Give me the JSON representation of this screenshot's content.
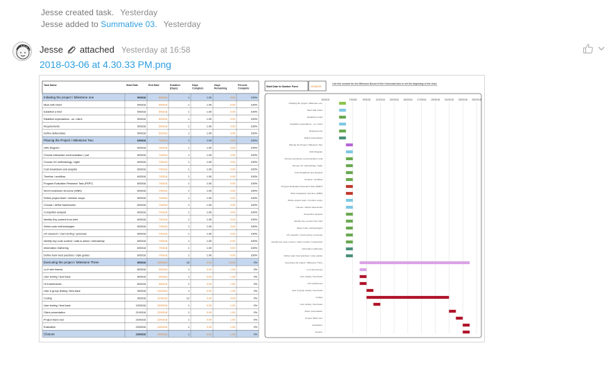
{
  "activity": [
    {
      "text": "Jesse created task.",
      "when": "Yesterday",
      "link": ""
    },
    {
      "text": "Jesse added to ",
      "link": "Summative 03.",
      "when": "Yesterday"
    }
  ],
  "message": {
    "author": "Jesse",
    "verb": "attached",
    "timestamp": "Yesterday at 16:58",
    "attachment": "2018-03-06 at 4.30.33 PM.png"
  },
  "icons": {
    "avatar": "avatar-sketch-icon",
    "attach": "paperclip-icon",
    "like": "thumbs-up-icon",
    "menu": "chevron-down-icon"
  },
  "colors": {
    "link": "#2d9ee0",
    "milestone_row": "#c5d7ee",
    "date_orange": "#e07b1a"
  },
  "attachment_image": {
    "table_headers": [
      "Task Name",
      "Start Date",
      "End Date",
      "Duration (Days)",
      "Days Complete",
      "Days Remaining",
      "Percent Complete"
    ],
    "start_box_label": "Start Date in Number Form",
    "start_box_value": "43158.00",
    "note": "Use this number for the Minimum Bound of the Horizontal Axis to set the beginning of the chart.",
    "axis_ticks": [
      "3/03/18",
      "7/03/18",
      "9/03/18",
      "11/03/18",
      "13/03/18",
      "15/03/18",
      "17/03/18",
      "19/03/18",
      "21/03/18",
      "23/03/18",
      "25/03/18"
    ],
    "rows": [
      {
        "task": "Initiating the project / Milestone one",
        "start": "5/03/18",
        "end": "5/03/18",
        "dur": "1",
        "done": "1.00",
        "rem": "0.00",
        "pct": "100%",
        "ms": true,
        "color": "#8bc34a",
        "s": 5,
        "e": 6
      },
      {
        "task": "Meet with Client",
        "start": "5/03/18",
        "end": "5/03/18",
        "dur": "1",
        "done": "1.00",
        "rem": "0.00",
        "pct": "100%",
        "ms": false,
        "color": "#7ec8e3",
        "s": 5,
        "e": 6
      },
      {
        "task": "Establish a brief",
        "start": "5/03/18",
        "end": "5/03/18",
        "dur": "1",
        "done": "1.00",
        "rem": "0.00",
        "pct": "100%",
        "ms": false,
        "color": "#6aa84f",
        "s": 5,
        "e": 6
      },
      {
        "task": "Establish expectations - us / client",
        "start": "5/03/18",
        "end": "5/03/18",
        "dur": "1",
        "done": "1.00",
        "rem": "0.00",
        "pct": "100%",
        "ms": false,
        "color": "#7ec8e3",
        "s": 5,
        "e": 6
      },
      {
        "task": "Requirements",
        "start": "5/03/18",
        "end": "5/03/18",
        "dur": "1",
        "done": "1.00",
        "rem": "0.00",
        "pct": "100%",
        "ms": false,
        "color": "#6aa84f",
        "s": 5,
        "e": 6
      },
      {
        "task": "Define deliverables",
        "start": "5/03/18",
        "end": "5/03/18",
        "dur": "1",
        "done": "1.00",
        "rem": "0.00",
        "pct": "100%",
        "ms": false,
        "color": "#4a8f7a",
        "s": 5,
        "e": 6
      },
      {
        "task": "Plannig the Project / Milestone Two",
        "start": "6/03/18",
        "end": "7/03/18",
        "dur": "1",
        "done": "1.00",
        "rem": "0.00",
        "pct": "100%",
        "ms": true,
        "color": "#b266d6",
        "s": 6,
        "e": 7
      },
      {
        "task": "UML Diagram",
        "start": "6/03/18",
        "end": "7/03/18",
        "dur": "1",
        "done": "1.00",
        "rem": "0.00",
        "pct": "100%",
        "ms": false,
        "color": "#7ec8e3",
        "s": 6,
        "e": 7
      },
      {
        "task": "Choose interactive communication / pull",
        "start": "6/03/18",
        "end": "7/03/18",
        "dur": "1",
        "done": "1.00",
        "rem": "0.00",
        "pct": "100%",
        "ms": false,
        "color": "#6aa84f",
        "s": 6,
        "e": 7
      },
      {
        "task": "Choose UX methodology / Agile",
        "start": "6/03/18",
        "end": "7/03/18",
        "dur": "1",
        "done": "1.00",
        "rem": "0.00",
        "pct": "100%",
        "ms": false,
        "color": "#6aa84f",
        "s": 6,
        "e": 7
      },
      {
        "task": "Cost breakdown and  anaylsis",
        "start": "6/03/18",
        "end": "7/03/18",
        "dur": "1",
        "done": "1.00",
        "rem": "0.00",
        "pct": "100%",
        "ms": false,
        "color": "#6aa84f",
        "s": 6,
        "e": 7
      },
      {
        "task": "Timeline / workflow",
        "start": "6/03/18",
        "end": "7/03/18",
        "dur": "1",
        "done": "1.00",
        "rem": "0.00",
        "pct": "100%",
        "ms": false,
        "color": "#6aa84f",
        "s": 6,
        "e": 7
      },
      {
        "task": "Program Evaluation Research Task (PERT)",
        "start": "6/03/18",
        "end": "7/03/18",
        "dur": "1",
        "done": "1.00",
        "rem": "0.00",
        "pct": "100%",
        "ms": false,
        "color": "#c0392b",
        "s": 6,
        "e": 7
      },
      {
        "task": "Work breakdown structure (WBS)",
        "start": "6/03/18",
        "end": "7/03/18",
        "dur": "1",
        "done": "1.00",
        "rem": "0.00",
        "pct": "100%",
        "ms": false,
        "color": "#c0392b",
        "s": 6,
        "e": 7
      },
      {
        "task": "Define project team / member scope",
        "start": "6/03/18",
        "end": "7/03/18",
        "dur": "1",
        "done": "1.00",
        "rem": "0.00",
        "pct": "100%",
        "ms": false,
        "color": "#7ec8e3",
        "s": 6,
        "e": 7
      },
      {
        "task": "Choose / define frameworks",
        "start": "6/03/18",
        "end": "7/03/18",
        "dur": "1",
        "done": "1.00",
        "rem": "0.00",
        "pct": "100%",
        "ms": false,
        "color": "#7ec8e3",
        "s": 6,
        "e": 7
      },
      {
        "task": "Competitor analysis",
        "start": "6/03/18",
        "end": "7/03/18",
        "dur": "1",
        "done": "1.00",
        "rem": "0.00",
        "pct": "100%",
        "ms": false,
        "color": "#6aa84f",
        "s": 6,
        "e": 7
      },
      {
        "task": "Identify Key content from brief",
        "start": "6/03/18",
        "end": "7/03/18",
        "dur": "1",
        "done": "1.00",
        "rem": "0.00",
        "pct": "100%",
        "ms": false,
        "color": "#6aa84f",
        "s": 6,
        "e": 7
      },
      {
        "task": "Select code methodologies",
        "start": "6/03/18",
        "end": "7/03/18",
        "dur": "1",
        "done": "1.00",
        "rem": "0.00",
        "pct": "100%",
        "ms": false,
        "color": "#6aa84f",
        "s": 6,
        "e": 7
      },
      {
        "task": "UX research / Card sorting / personas",
        "start": "6/03/18",
        "end": "7/03/18",
        "dur": "1",
        "done": "1.00",
        "rem": "0.00",
        "pct": "100%",
        "ms": false,
        "color": "#6aa84f",
        "s": 6,
        "e": 7
      },
      {
        "task": "Identify key code content / calls to action / interactivity",
        "start": "6/03/18",
        "end": "7/03/18",
        "dur": "1",
        "done": "1.00",
        "rem": "0.00",
        "pct": "100%",
        "ms": false,
        "color": "#6aa84f",
        "s": 6,
        "e": 7
      },
      {
        "task": "Information Gathering",
        "start": "6/03/18",
        "end": "7/03/18",
        "dur": "1",
        "done": "1.00",
        "rem": "0.00",
        "pct": "100%",
        "ms": false,
        "color": "#4a8f7a",
        "s": 6,
        "e": 7
      },
      {
        "task": "Define team best practises / style guides",
        "start": "6/03/18",
        "end": "7/03/18",
        "dur": "1",
        "done": "1.00",
        "rem": "0.00",
        "pct": "100%",
        "ms": false,
        "color": "#4a8f7a",
        "s": 6,
        "e": 7
      },
      {
        "task": "Executing the project / Milestone Three",
        "start": "8/03/18",
        "end": "23/03/18",
        "dur": "16",
        "done": "0.00",
        "rem": "13.00",
        "pct": "0%",
        "ms": true,
        "color": "#d9a3e6",
        "s": 8,
        "e": 24
      },
      {
        "task": "Lo-fi wire frames",
        "start": "8/03/18",
        "end": "9/03/18",
        "dur": "1",
        "done": "0.00",
        "rem": "1.00",
        "pct": "0%",
        "ms": false,
        "color": "#d9a3e6",
        "s": 8,
        "e": 9
      },
      {
        "task": "User testing / feed back",
        "start": "8/03/18",
        "end": "9/03/18",
        "dur": "1",
        "done": "0.00",
        "rem": "1.00",
        "pct": "0%",
        "ms": false,
        "color": "#b0152a",
        "s": 8,
        "e": 9
      },
      {
        "task": "Hi-fi wireframes",
        "start": "8/03/18",
        "end": "9/03/18",
        "dur": "1",
        "done": "0.00",
        "rem": "1.00",
        "pct": "0%",
        "ms": false,
        "color": "#b0152a",
        "s": 8,
        "e": 9
      },
      {
        "task": "User & group testing / feed back",
        "start": "9/03/18",
        "end": "10/03/18",
        "dur": "1",
        "done": "0.00",
        "rem": "1.00",
        "pct": "0%",
        "ms": false,
        "color": "#b0152a",
        "s": 9,
        "e": 10
      },
      {
        "task": "Coding",
        "start": "9/03/18",
        "end": "21/03/18",
        "dur": "12",
        "done": "0.00",
        "rem": "0.00",
        "pct": "0%",
        "ms": false,
        "color": "#b0152a",
        "s": 9,
        "e": 21
      },
      {
        "task": "User testing / feed back",
        "start": "10/03/18",
        "end": "20/03/18",
        "dur": "1",
        "done": "0.00",
        "rem": "1.00",
        "pct": "0%",
        "ms": false,
        "color": "#b0152a",
        "s": 10,
        "e": 11
      },
      {
        "task": "Client presentation",
        "start": "21/03/18",
        "end": "22/03/18",
        "dur": "1",
        "done": "0.00",
        "rem": "1.00",
        "pct": "0%",
        "ms": false,
        "color": "#b0152a",
        "s": 21,
        "e": 22
      },
      {
        "task": "Project Hand over",
        "start": "22/03/18",
        "end": "23/03/18",
        "dur": "1",
        "done": "0.00",
        "rem": "1.00",
        "pct": "0%",
        "ms": false,
        "color": "#b0152a",
        "s": 22,
        "e": 23
      },
      {
        "task": "Evaluation",
        "start": "23/03/18",
        "end": "24/03/18",
        "dur": "1",
        "done": "0.00",
        "rem": "1.00",
        "pct": "0%",
        "ms": false,
        "color": "#b0152a",
        "s": 23,
        "e": 24
      },
      {
        "task": "Closure",
        "start": "23/03/18",
        "end": "24/03/18",
        "dur": "1",
        "done": "0.00",
        "rem": "1.00",
        "pct": "0%",
        "ms": true,
        "color": "#b0152a",
        "s": 23,
        "e": 24
      }
    ]
  }
}
